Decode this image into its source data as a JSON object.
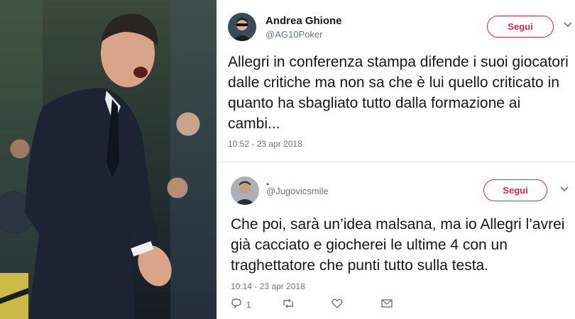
{
  "tweets": [
    {
      "name": "Andrea Ghione",
      "handle": "@AG10Poker",
      "follow_label": "Segui",
      "text": "Allegri in conferenza stampa difende i suoi giocatori dalle critiche ma non sa che è lui quello criticato in quanto ha sbagliato tutto dalla formazione ai cambi...",
      "timestamp": "10:52 - 23 apr 2018",
      "menu_icon": "chevron-down-icon"
    },
    {
      "name": "-",
      "handle": "@Jugovicsmile",
      "follow_label": "Segui",
      "text": "Che poi, sarà un’idea malsana, ma io Allegri l’avrei già cacciato e giocherei le ultime 4 con un traghettatore che punti tutto sulla testa.",
      "timestamp": "10:14 - 23 apr 2018",
      "menu_icon": "chevron-down-icon",
      "actions": {
        "reply_count": "1",
        "reply_icon": "reply-icon",
        "retweet_icon": "retweet-icon",
        "like_icon": "heart-icon",
        "message_icon": "direct-message-icon"
      }
    }
  ],
  "colors": {
    "follow_accent": "#e2264d",
    "secondary_text": "#657786",
    "primary_text": "#14171a"
  }
}
